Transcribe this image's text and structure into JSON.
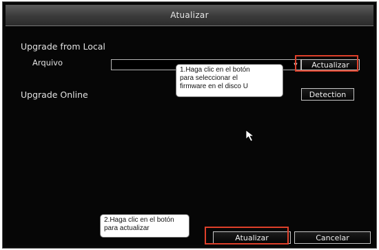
{
  "window": {
    "title": "Atualizar"
  },
  "local": {
    "section_label": "Upgrade from Local",
    "file_label": "Arquivo",
    "file_value": "",
    "update_button": "Actualizar"
  },
  "online": {
    "section_label": "Upgrade Online",
    "detect_button": "Detection"
  },
  "footer": {
    "update_button": "Atualizar",
    "cancel_button": "Cancelar"
  },
  "callouts": {
    "first": [
      "1.Haga clic en el botón",
      "para seleccionar el",
      "firmware en el disco U"
    ],
    "second": [
      "2.Haga clic en el botón",
      "para actualizar"
    ]
  },
  "colors": {
    "highlight": "#e0402a",
    "window_bg": "#060606",
    "title_bg": "#4a4a4a"
  },
  "icons": {
    "dropdown": "triangle-down",
    "cursor": "arrow-pointer"
  }
}
